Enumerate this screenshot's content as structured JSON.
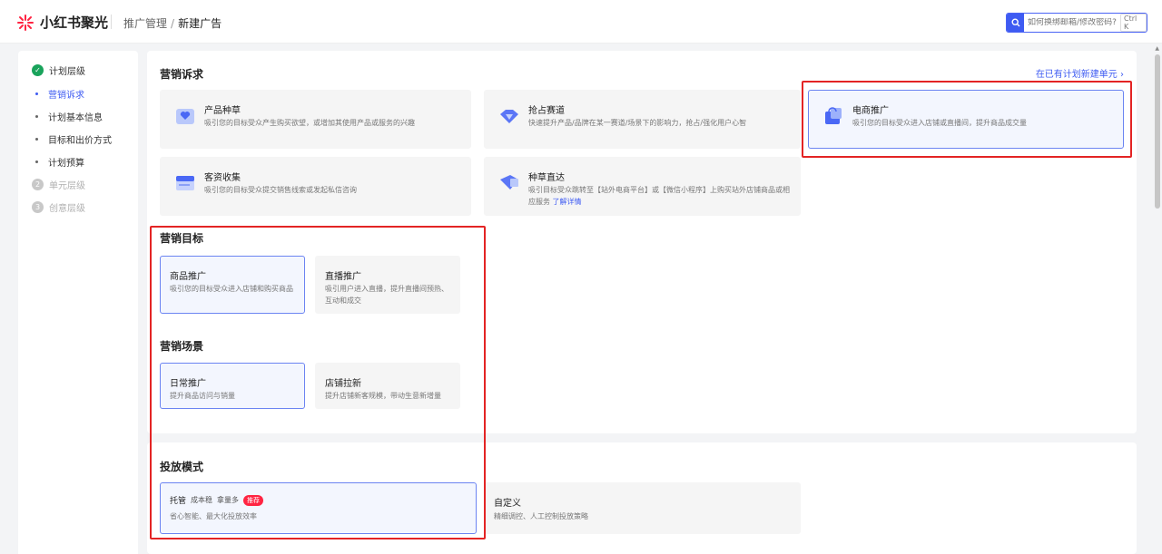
{
  "app": {
    "name": "小红书聚光"
  },
  "breadcrumb": {
    "parent": "推广管理",
    "separator": "/",
    "current": "新建广告"
  },
  "search": {
    "placeholder": "如何换绑邮箱/修改密码?",
    "shortcut": "Ctrl K"
  },
  "sidebar": {
    "steps": [
      {
        "label": "计划层级",
        "state": "done"
      },
      {
        "label": "单元层级",
        "state": "todo",
        "number": "2"
      },
      {
        "label": "创意层级",
        "state": "todo",
        "number": "3"
      }
    ],
    "sub_items": [
      {
        "label": "营销诉求",
        "active": true
      },
      {
        "label": "计划基本信息",
        "active": false
      },
      {
        "label": "目标和出价方式",
        "active": false
      },
      {
        "label": "计划预算",
        "active": false
      }
    ]
  },
  "marketing_need": {
    "title": "营销诉求",
    "link": "在已有计划新建单元",
    "cards": [
      {
        "title": "产品种草",
        "desc": "吸引您的目标受众产生购买欲望，或增加其使用产品或服务的兴趣",
        "icon": "heart-box-icon"
      },
      {
        "title": "抢占赛道",
        "desc": "快速提升产品/品牌在某一赛道/场景下的影响力，抢占/强化用户心智",
        "icon": "diamond-icon"
      },
      {
        "title": "电商推广",
        "desc": "吸引您的目标受众进入店铺或直播间，提升商品成交量",
        "icon": "shopping-bag-icon",
        "selected": true
      },
      {
        "title": "客资收集",
        "desc": "吸引您的目标受众提交销售线索或发起私信咨询",
        "icon": "form-icon"
      },
      {
        "title": "种草直达",
        "desc": "吸引目标受众跳转至【站外电商平台】或【微信小程序】上购买站外店铺商品或相应服务",
        "more": "了解详情",
        "icon": "shortcut-icon"
      }
    ]
  },
  "marketing_goal": {
    "title": "营销目标",
    "cards": [
      {
        "title": "商品推广",
        "desc": "吸引您的目标受众进入店铺和购买商品",
        "selected": true
      },
      {
        "title": "直播推广",
        "desc": "吸引用户进入直播，提升直播间预热、互动和成交",
        "selected": false
      }
    ]
  },
  "marketing_scene": {
    "title": "营销场景",
    "cards": [
      {
        "title": "日常推广",
        "desc": "提升商品访问与销量",
        "selected": true
      },
      {
        "title": "店铺拉新",
        "desc": "提升店铺新客规模，带动生意新增量",
        "selected": false
      }
    ]
  },
  "delivery_mode": {
    "title": "投放模式",
    "cards": [
      {
        "title": "托管",
        "tags": [
          "成本稳",
          "拿量多"
        ],
        "badge": "推荐",
        "desc": "省心智能、最大化投放效率",
        "selected": true
      },
      {
        "title": "自定义",
        "desc": "精细调控、人工控制投放策略",
        "selected": false
      }
    ]
  },
  "colors": {
    "accent": "#3e5bf2",
    "highlight": "#e32424",
    "brand": "#ff2442",
    "success": "#19a35b"
  }
}
